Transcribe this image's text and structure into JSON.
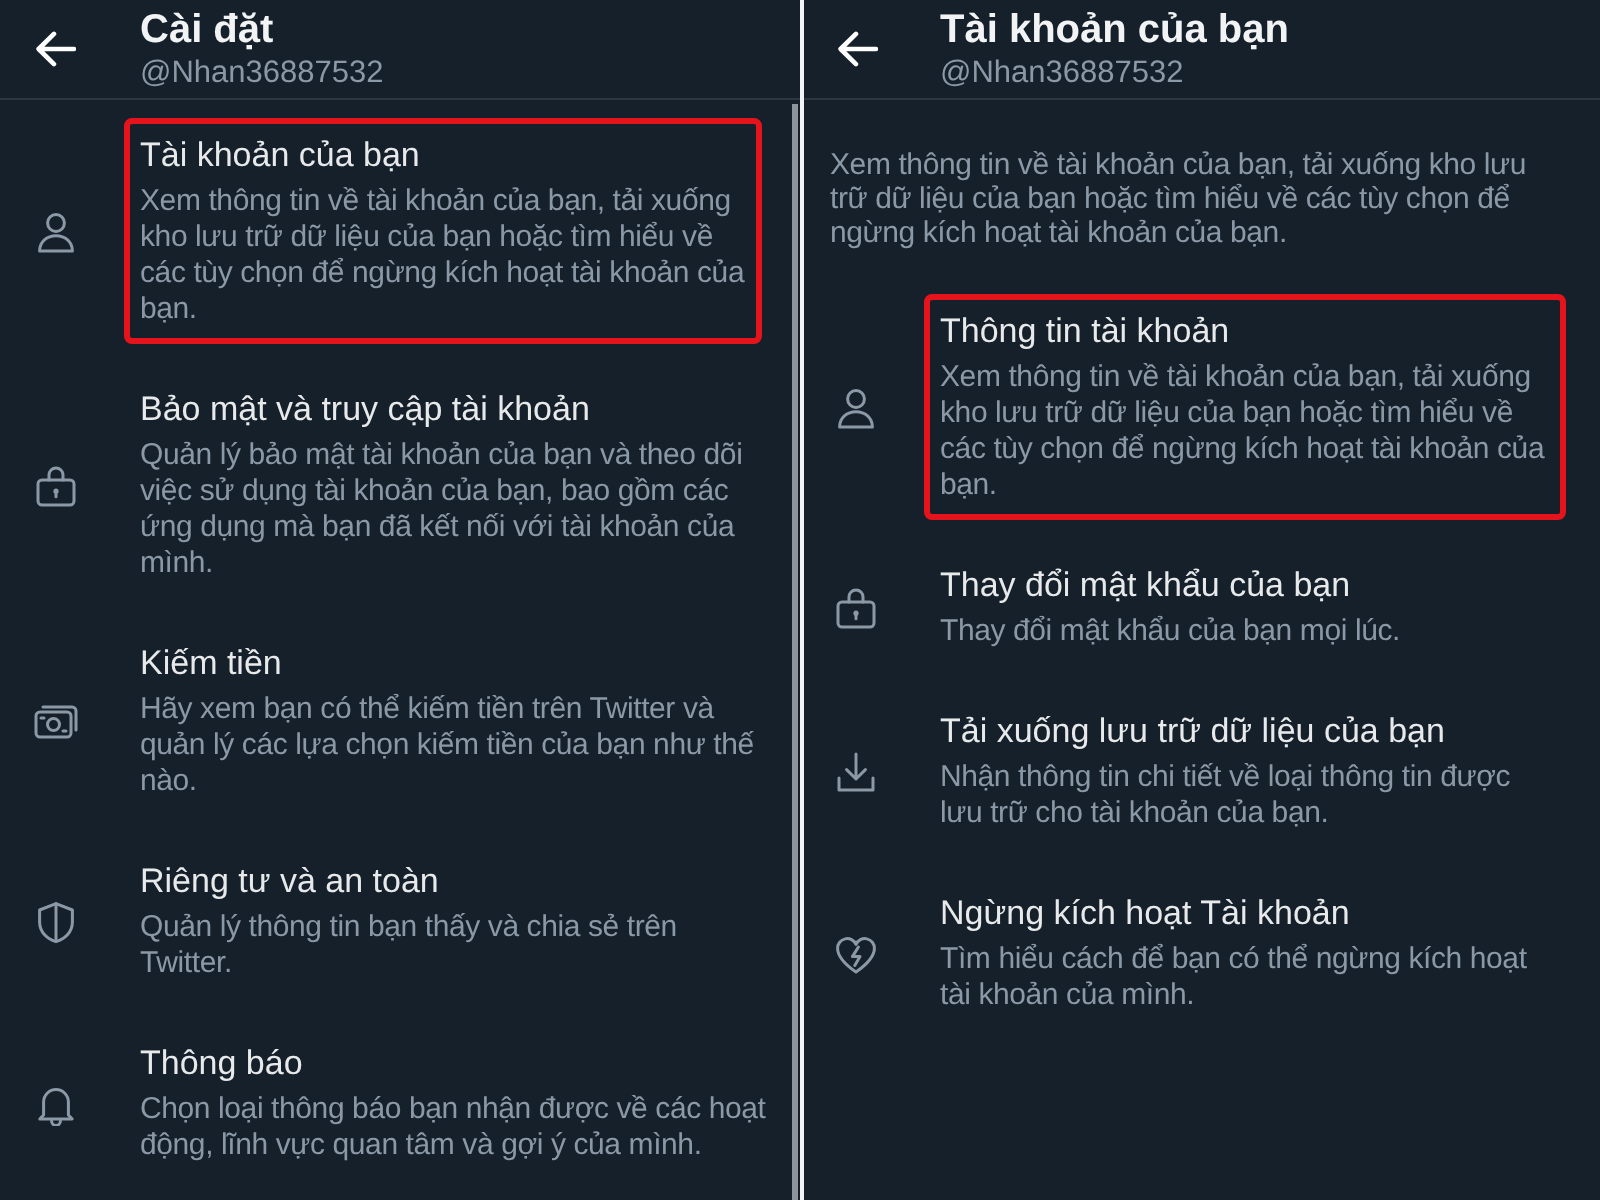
{
  "panels": [
    {
      "header": {
        "title": "Cài đặt",
        "username": "@Nhan36887532"
      },
      "scrollbar": true,
      "items": [
        {
          "kind": "account",
          "title": "Tài khoản của bạn",
          "description": "Xem thông tin về tài khoản của bạn, tải xuống kho lưu trữ dữ liệu của bạn hoặc tìm hiểu về các tùy chọn để ngừng kích hoạt tài khoản của bạn.",
          "highlighted": true
        },
        {
          "kind": "security",
          "title": "Bảo mật và truy cập tài khoản",
          "description": "Quản lý bảo mật tài khoản của bạn và theo dõi việc sử dụng tài khoản của bạn, bao gồm các ứng dụng mà bạn đã kết nối với tài khoản của mình.",
          "highlighted": false
        },
        {
          "kind": "monetization",
          "title": "Kiếm tiền",
          "description": "Hãy xem bạn có thể kiếm tiền trên Twitter và quản lý các lựa chọn kiếm tiền của bạn như thế nào.",
          "highlighted": false
        },
        {
          "kind": "privacy",
          "title": "Riêng tư và an toàn",
          "description": "Quản lý thông tin bạn thấy và chia sẻ trên Twitter.",
          "highlighted": false
        },
        {
          "kind": "notifications",
          "title": "Thông báo",
          "description": "Chọn loại thông báo bạn nhận được về các hoạt động, lĩnh vực quan tâm và gợi ý của mình.",
          "highlighted": false
        }
      ]
    },
    {
      "header": {
        "title": "Tài khoản của bạn",
        "username": "@Nhan36887532"
      },
      "intro": "Xem thông tin về tài khoản của bạn, tải xuống kho lưu trữ dữ liệu của bạn hoặc tìm hiểu về các tùy chọn để ngừng kích hoạt tài khoản của bạn.",
      "items": [
        {
          "kind": "account",
          "title": "Thông tin tài khoản",
          "description": "Xem thông tin về tài khoản của bạn, tải xuống kho lưu trữ dữ liệu của bạn hoặc tìm hiểu về các tùy chọn để ngừng kích hoạt tài khoản của bạn.",
          "highlighted": true
        },
        {
          "kind": "password",
          "title": "Thay đổi mật khẩu của bạn",
          "description": "Thay đổi mật khẩu của bạn mọi lúc.",
          "highlighted": false
        },
        {
          "kind": "archive",
          "title": "Tải xuống lưu trữ dữ liệu của bạn",
          "description": "Nhận thông tin chi tiết về loại thông tin được lưu trữ cho tài khoản của bạn.",
          "highlighted": false
        },
        {
          "kind": "deactivation",
          "title": "Ngừng kích hoạt Tài khoản",
          "description": "Tìm hiểu cách để bạn có thể ngừng kích hoạt tài khoản của mình.",
          "highlighted": false
        }
      ]
    }
  ]
}
